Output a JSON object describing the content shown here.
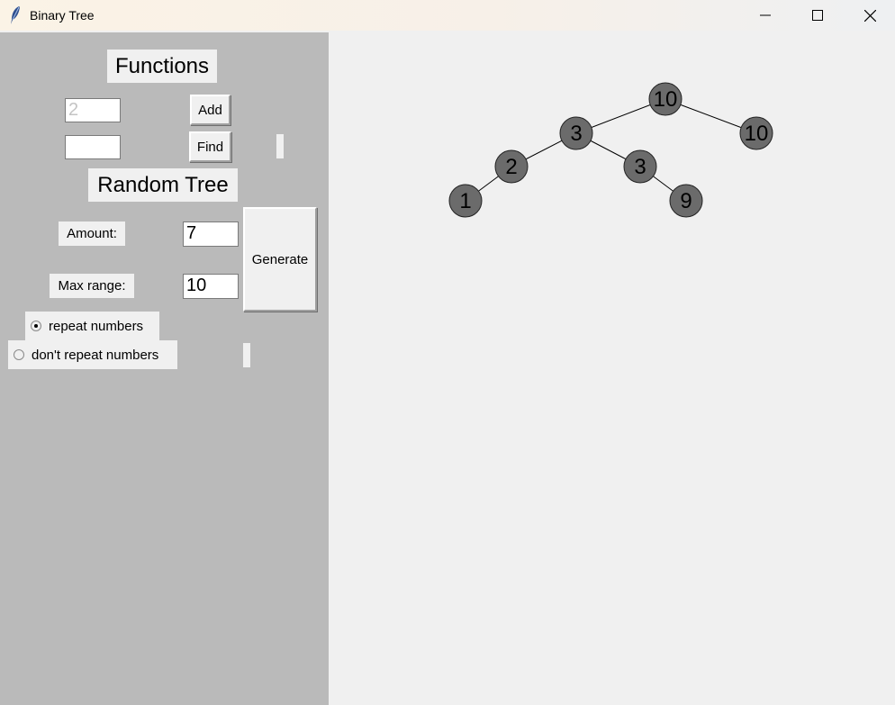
{
  "window": {
    "title": "Binary Tree"
  },
  "functions": {
    "heading": "Functions",
    "add_input_placeholder": "2",
    "add_button": "Add",
    "find_input_value": "",
    "find_button": "Find"
  },
  "random_tree": {
    "heading": "Random Tree",
    "amount_label": "Amount:",
    "amount_value": "7",
    "max_range_label": "Max range:",
    "max_range_value": "10",
    "generate_button": "Generate",
    "options": [
      {
        "label": "repeat numbers",
        "selected": true
      },
      {
        "label": "don't repeat numbers",
        "selected": false
      }
    ]
  },
  "tree": {
    "nodes": [
      {
        "id": "n0",
        "value": "10"
      },
      {
        "id": "n1",
        "value": "3"
      },
      {
        "id": "n2",
        "value": "10"
      },
      {
        "id": "n3",
        "value": "2"
      },
      {
        "id": "n4",
        "value": "3"
      },
      {
        "id": "n5",
        "value": "1"
      },
      {
        "id": "n6",
        "value": "9"
      }
    ],
    "edges": [
      [
        "n0",
        "n1"
      ],
      [
        "n0",
        "n2"
      ],
      [
        "n1",
        "n3"
      ],
      [
        "n1",
        "n4"
      ],
      [
        "n3",
        "n5"
      ],
      [
        "n4",
        "n6"
      ]
    ],
    "node_fill": "#6b6b6b"
  }
}
